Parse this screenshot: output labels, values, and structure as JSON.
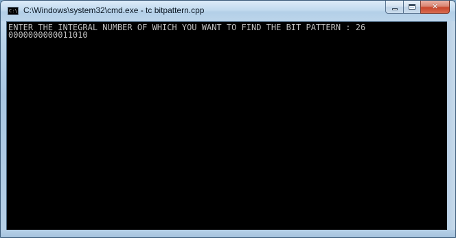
{
  "window": {
    "title": "C:\\Windows\\system32\\cmd.exe - tc  bitpattern.cpp",
    "icon": "cmd-icon",
    "icon_text": "C:\\"
  },
  "caption_buttons": {
    "minimize": "minimize-icon",
    "maximize": "maximize-icon",
    "close": "close-icon",
    "close_glyph": "✕"
  },
  "console": {
    "lines": [
      "ENTER THE INTEGRAL NUMBER OF WHICH YOU WANT TO FIND THE BIT PATTERN : 26",
      "0000000000011010"
    ],
    "foreground": "#c0c0c0",
    "background": "#000000"
  }
}
